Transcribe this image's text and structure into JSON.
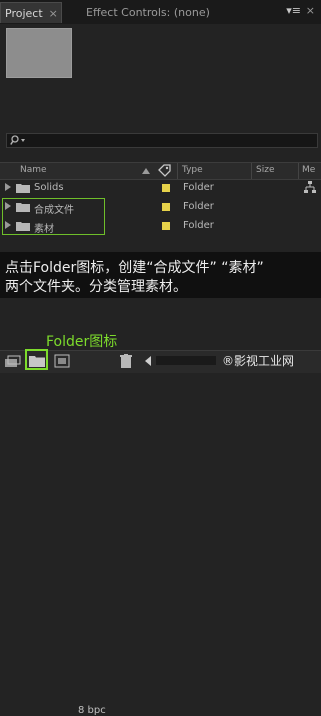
{
  "tabs": {
    "project": "Project",
    "project_close": "×",
    "effect_controls": "Effect Controls: (none)",
    "menu_glyph": "▾≡"
  },
  "columns": {
    "name": "Name",
    "type": "Type",
    "size": "Size",
    "media": "Me"
  },
  "rows": [
    {
      "name": "Solids",
      "type": "Folder"
    },
    {
      "name": "合成文件",
      "type": "Folder"
    },
    {
      "name": "素材",
      "type": "Folder"
    }
  ],
  "annotation": {
    "line1": "点击Folder图标，创建“合成文件” “素材”",
    "line2": "两个文件夹。分类管理素材。",
    "folder_caption": "Folder图标"
  },
  "bottom": {
    "bpc": "8 bpc"
  },
  "watermark": "®影视工业网",
  "colors": {
    "folder_label": "#e6d24a",
    "highlight": "#7ddc2c"
  }
}
